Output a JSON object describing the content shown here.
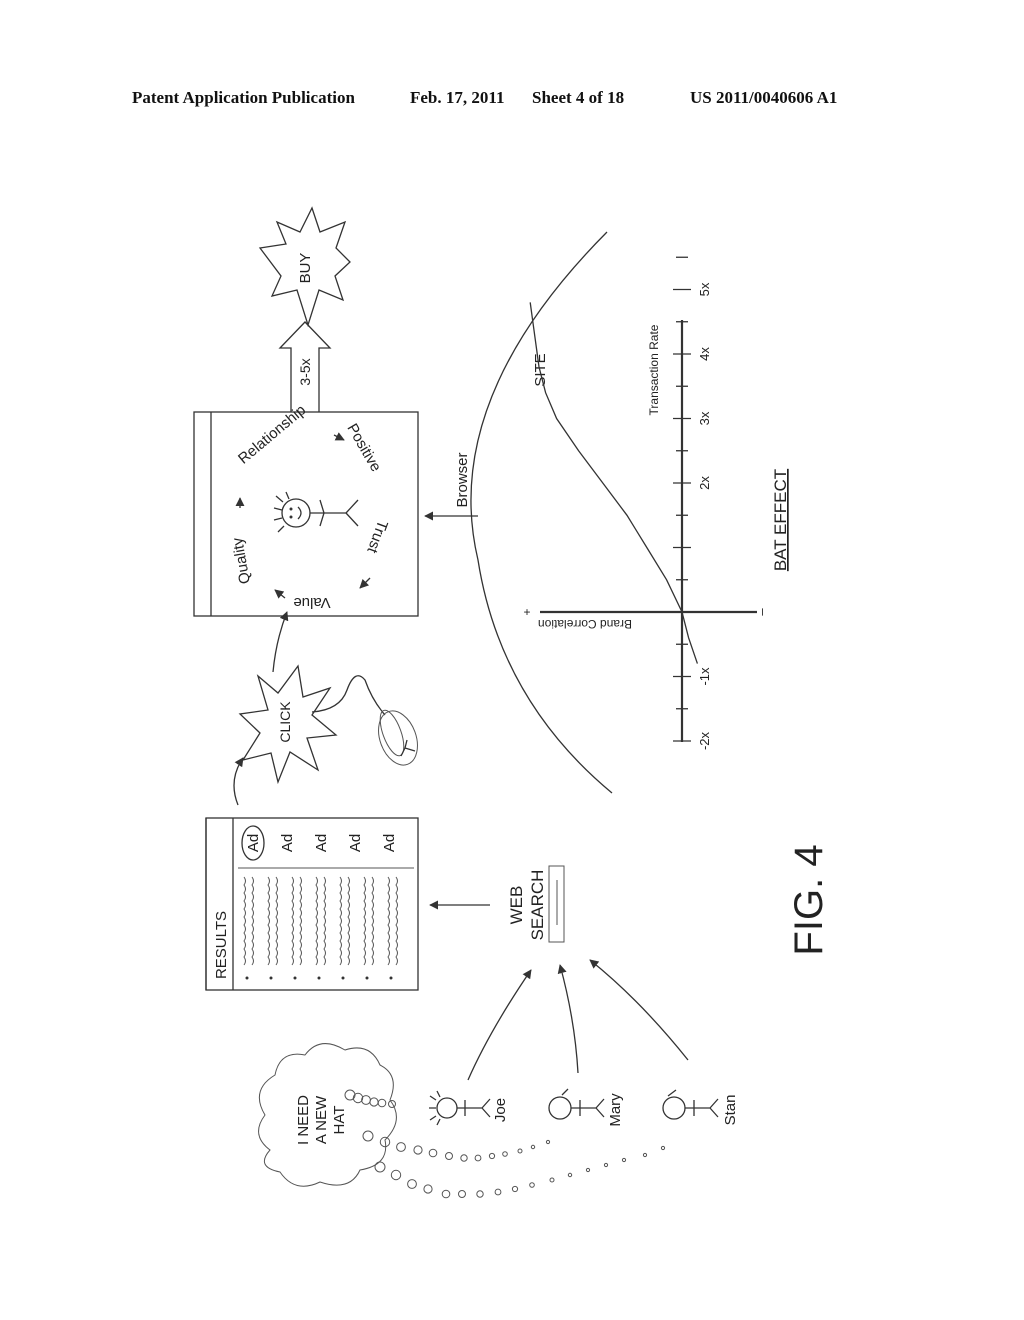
{
  "header": {
    "left": "Patent Application Publication",
    "date": "Feb. 17, 2011",
    "sheet": "Sheet 4 of 18",
    "number": "US 2011/0040606 A1"
  },
  "figure": {
    "label": "FIG. 4",
    "thought": [
      "I NEED",
      "A NEW",
      "HAT"
    ],
    "people": [
      {
        "name": "Joe",
        "icon": "stick-figure-spiky-hair-icon"
      },
      {
        "name": "Mary",
        "icon": "stick-figure-icon"
      },
      {
        "name": "Stan",
        "icon": "stick-figure-icon"
      }
    ],
    "web_search": [
      "WEB",
      "SEARCH"
    ],
    "results": {
      "title": "RESULTS",
      "ads": [
        "Ad",
        "Ad",
        "Ad",
        "Ad",
        "Ad"
      ],
      "result_rows": 7,
      "selected_ad_index": 0
    },
    "click_label": "CLICK",
    "mouse_icon": "computer-mouse-icon",
    "site_cycle": [
      "Relationship",
      "Positive",
      "Trust",
      "Value",
      "Quality"
    ],
    "arrow_label": "3-5x",
    "buy_label": "BUY",
    "browser_label": "Browser",
    "site_label": "SITE"
  },
  "chart_data": {
    "type": "line",
    "title": "BAT EFFECT",
    "xlabel": "Transaction Rate",
    "ylabel": "Brand Correlation",
    "x_ticks": [
      "-2x",
      "-1x",
      "2x",
      "3x",
      "4x",
      "5x"
    ],
    "x_tick_values": [
      -2,
      -1,
      2,
      3,
      4,
      5
    ],
    "xlim": [
      -3,
      6
    ],
    "ylim": [
      -1,
      5
    ],
    "y_axis_signs": {
      "positive": "+",
      "negative": "–"
    },
    "grid": false,
    "series": [
      {
        "name": "SITE",
        "x": [
          -0.8,
          -0.4,
          0,
          0.5,
          1,
          1.5,
          2,
          2.5,
          3,
          3.4,
          3.8,
          4.3,
          4.8
        ],
        "y": [
          -0.35,
          -0.15,
          0,
          0.35,
          0.8,
          1.25,
          1.8,
          2.35,
          2.85,
          3.1,
          3.25,
          3.35,
          3.45
        ]
      }
    ]
  }
}
